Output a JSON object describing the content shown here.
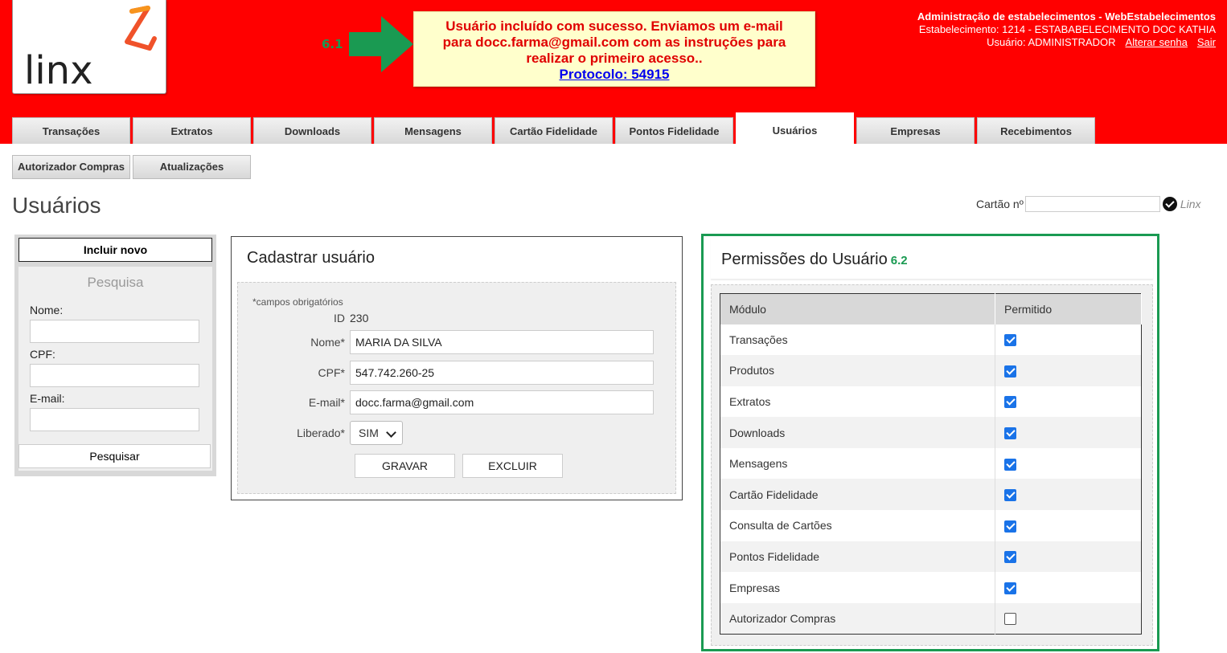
{
  "header": {
    "logo_text": "Linx",
    "step_61": "6.1",
    "message": {
      "line1": "Usuário incluído com sucesso. Enviamos um e-mail",
      "line2": "para docc.farma@gmail.com com as instruções para",
      "line3": "realizar o primeiro acesso..",
      "protocol": "Protocolo: 54915"
    },
    "admin_title": "Administração de estabelecimentos - WebEstabelecimentos",
    "establishment": "Estabelecimento: 1214 - ESTABABELECIMENTO DOC KATHIA",
    "user": "Usuário: ADMINISTRADOR",
    "change_password": "Alterar senha",
    "logout": "Sair",
    "colors": {
      "bar": "#ff0000",
      "arrow": "#1a9a52"
    }
  },
  "tabs": [
    "Transações",
    "Extratos",
    "Downloads",
    "Mensagens",
    "Cartão Fidelidade",
    "Pontos Fidelidade",
    "Usuários",
    "Empresas",
    "Recebimentos"
  ],
  "active_tab": "Usuários",
  "subtabs": [
    "Autorizador Compras",
    "Atualizações"
  ],
  "page_title": "Usuários",
  "cartao": {
    "label": "Cartão nº",
    "value": "",
    "mini_logo": "Linx"
  },
  "left": {
    "new_button": "Incluir novo",
    "search_title": "Pesquisa",
    "name_label": "Nome:",
    "cpf_label": "CPF:",
    "email_label": "E-mail:",
    "search_button": "Pesquisar"
  },
  "form": {
    "title": "Cadastrar usuário",
    "required_note": "*campos obrigatórios",
    "id_label": "ID",
    "id_value": "230",
    "name_label": "Nome*",
    "name_value": "MARIA DA SILVA",
    "cpf_label": "CPF*",
    "cpf_value": "547.742.260-25",
    "email_label": "E-mail*",
    "email_value": "docc.farma@gmail.com",
    "liberado_label": "Liberado*",
    "liberado_value": "SIM",
    "save_button": "GRAVAR",
    "delete_button": "EXCLUIR"
  },
  "permissions": {
    "title": "Permissões do Usuário",
    "step": "6.2",
    "col_module": "Módulo",
    "col_allowed": "Permitido",
    "rows": [
      {
        "module": "Transações",
        "allowed": true
      },
      {
        "module": "Produtos",
        "allowed": true
      },
      {
        "module": "Extratos",
        "allowed": true
      },
      {
        "module": "Downloads",
        "allowed": true
      },
      {
        "module": "Mensagens",
        "allowed": true
      },
      {
        "module": "Cartão Fidelidade",
        "allowed": true
      },
      {
        "module": "Consulta de Cartões",
        "allowed": true
      },
      {
        "module": "Pontos Fidelidade",
        "allowed": true
      },
      {
        "module": "Empresas",
        "allowed": true
      },
      {
        "module": "Autorizador Compras",
        "allowed": false
      }
    ]
  }
}
